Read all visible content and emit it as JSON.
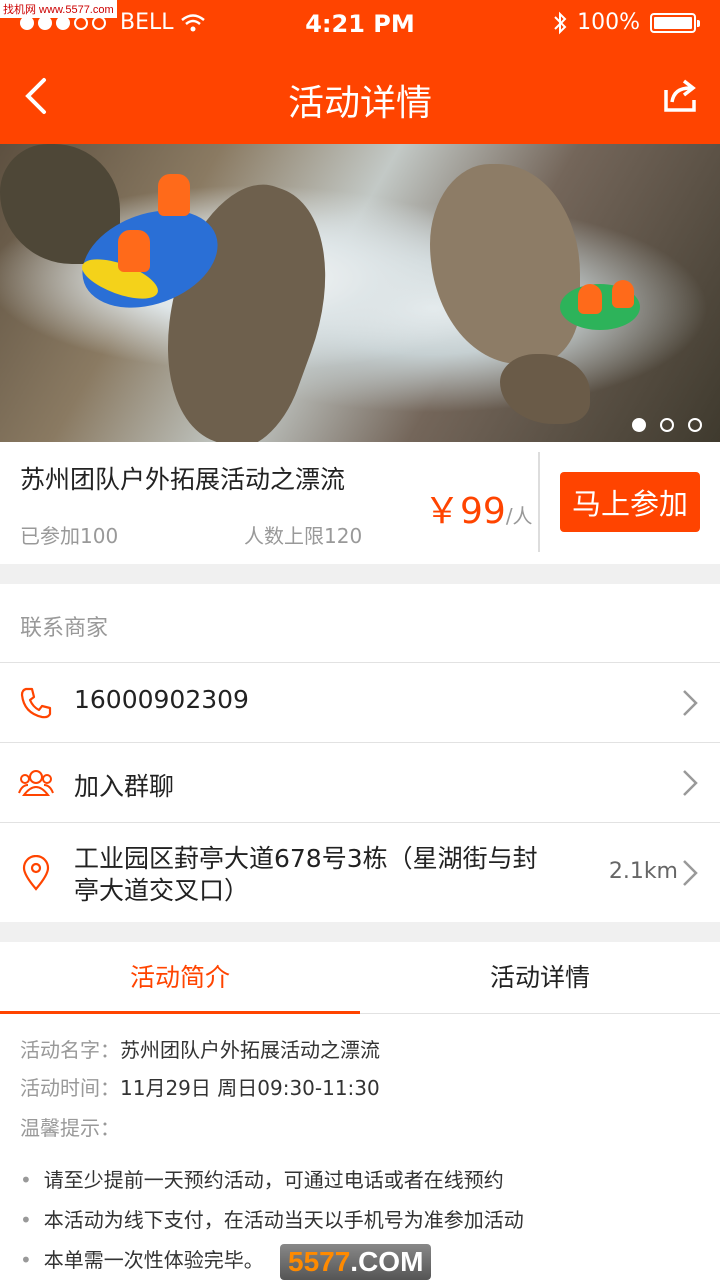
{
  "watermark_top": "找机网 www.5577.com",
  "status": {
    "carrier": "BELL",
    "time": "4:21 PM",
    "battery": "100%"
  },
  "nav": {
    "title": "活动详情",
    "back_icon": "chevron-left-icon",
    "share_icon": "share-icon"
  },
  "banner": {
    "pager_total": 3,
    "pager_active": 1
  },
  "activity": {
    "name": "苏州团队户外拓展活动之漂流",
    "joined": "已参加100",
    "limit": "人数上限120",
    "price": "￥99",
    "price_unit": "/人",
    "join_label": "马上参加"
  },
  "contact": {
    "header": "联系商家",
    "phone": "16000902309",
    "group_chat": "加入群聊",
    "address_line1": "工业园区葑亭大道678号3栋（星湖街与封",
    "address_line2": "亭大道交叉口）",
    "distance": "2.1km"
  },
  "tabs": [
    {
      "label": "活动简介",
      "active": true
    },
    {
      "label": "活动详情",
      "active": false
    }
  ],
  "intro": {
    "name_label": "活动名字：",
    "name_value": "苏州团队户外拓展活动之漂流",
    "time_label": "活动时间：",
    "time_value": "11月29日 周日09:30-11:30",
    "tips_label": "温馨提示：",
    "tips": [
      "请至少提前一天预约活动，可通过电话或者在线预约",
      "本活动为线下支付，在活动当天以手机号为准参加活动",
      "本单需一次性体验完毕。"
    ]
  },
  "watermark": {
    "num": "5577",
    "suffix": ".COM"
  },
  "colors": {
    "accent": "#ff4400",
    "muted": "#999999"
  }
}
